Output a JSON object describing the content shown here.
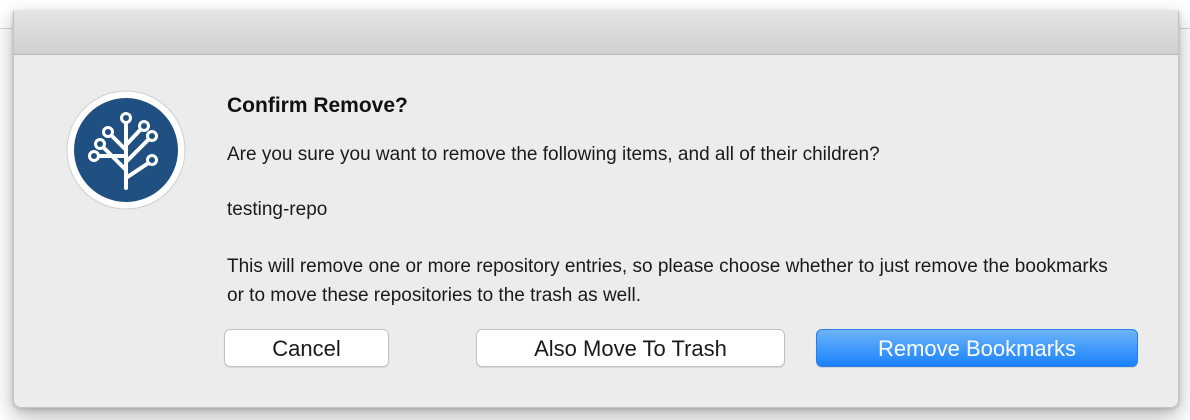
{
  "dialog": {
    "title": "Confirm Remove?",
    "question": "Are you sure you want to remove the following items, and all of their children?",
    "item": "testing-repo",
    "explanation": "This will remove one or more repository entries, so please choose whether to just remove the bookmarks or to move these repositories to the trash as well."
  },
  "buttons": {
    "cancel": "Cancel",
    "trash": "Also Move To Trash",
    "remove": "Remove Bookmarks"
  },
  "icon": {
    "name": "sourcetree-app-icon",
    "color": "#205081"
  }
}
